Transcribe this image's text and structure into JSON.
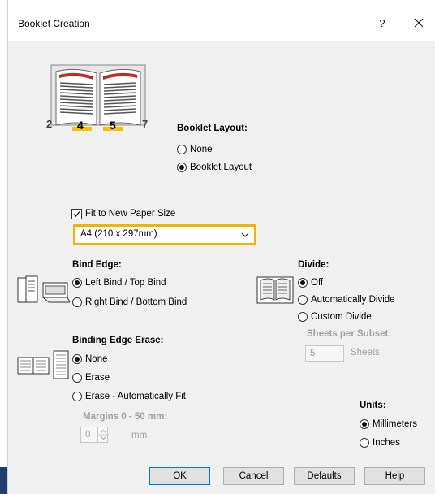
{
  "window": {
    "title": "Booklet Creation",
    "help": "?",
    "close": "close"
  },
  "booklet_layout": {
    "heading": "Booklet Layout:",
    "options": [
      "None",
      "Booklet Layout"
    ],
    "selected": "Booklet Layout",
    "preview_pages": [
      "2",
      "4",
      "5",
      "7"
    ]
  },
  "fit_paper": {
    "label": "Fit to New Paper Size",
    "checked": true,
    "selected_size": "A4 (210 x 297mm)",
    "highlight_color": "#f5b200"
  },
  "bind_edge": {
    "heading": "Bind Edge:",
    "options": [
      "Left Bind / Top Bind",
      "Right Bind / Bottom Bind"
    ],
    "selected": "Left Bind / Top Bind"
  },
  "divide": {
    "heading": "Divide:",
    "options": [
      "Off",
      "Automatically Divide",
      "Custom Divide"
    ],
    "selected": "Off",
    "sheets_per_subset_label": "Sheets per Subset:",
    "sheets_value": "5",
    "sheets_unit": "Sheets"
  },
  "binding_edge_erase": {
    "heading": "Binding Edge Erase:",
    "options": [
      "None",
      "Erase",
      "Erase - Automatically Fit"
    ],
    "selected": "None",
    "margins_label": "Margins 0 - 50 mm:",
    "margin_value": "0",
    "margin_unit": "mm"
  },
  "units": {
    "heading": "Units:",
    "options": [
      "Millimeters",
      "Inches"
    ],
    "selected": "Millimeters"
  },
  "buttons": {
    "ok": "OK",
    "cancel": "Cancel",
    "defaults": "Defaults",
    "help": "Help"
  }
}
